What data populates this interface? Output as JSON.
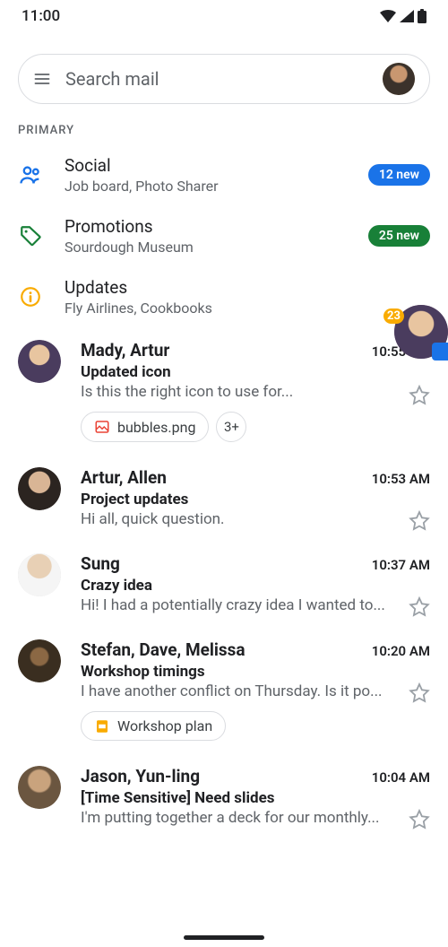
{
  "status": {
    "time": "11:00"
  },
  "search": {
    "placeholder": "Search mail"
  },
  "section_label": "PRIMARY",
  "tabs": [
    {
      "icon": "people-icon",
      "title": "Social",
      "subtitle": "Job board, Photo Sharer",
      "badge": "12 new",
      "badge_color": "blue"
    },
    {
      "icon": "tag-icon",
      "title": "Promotions",
      "subtitle": "Sourdough Museum",
      "badge": "25 new",
      "badge_color": "green"
    },
    {
      "icon": "info-icon",
      "title": "Updates",
      "subtitle": "Fly Airlines, Cookbooks",
      "badge": "",
      "badge_color": ""
    }
  ],
  "chat_head": {
    "badge": "23"
  },
  "emails": [
    {
      "sender": "Mady, Artur",
      "time": "10:55 AM",
      "subject": "Updated icon",
      "preview": "Is this the right icon to use for...",
      "chips": [
        {
          "icon": "image-icon",
          "label": "bubbles.png"
        }
      ],
      "extra": "3+"
    },
    {
      "sender": "Artur, Allen",
      "time": "10:53 AM",
      "subject": "Project updates",
      "preview": "Hi all, quick question."
    },
    {
      "sender": "Sung",
      "time": "10:37 AM",
      "subject": "Crazy idea",
      "preview": "Hi! I had a potentially crazy idea I wanted to..."
    },
    {
      "sender": "Stefan, Dave, Melissa",
      "time": "10:20 AM",
      "subject": "Workshop timings",
      "preview": "I have another conflict on Thursday. Is it po...",
      "chips": [
        {
          "icon": "slides-icon",
          "label": "Workshop plan"
        }
      ]
    },
    {
      "sender": "Jason, Yun-ling",
      "time": "10:04 AM",
      "subject": "[Time Sensitive] Need slides",
      "preview": "I'm putting together a deck for our monthly..."
    }
  ]
}
